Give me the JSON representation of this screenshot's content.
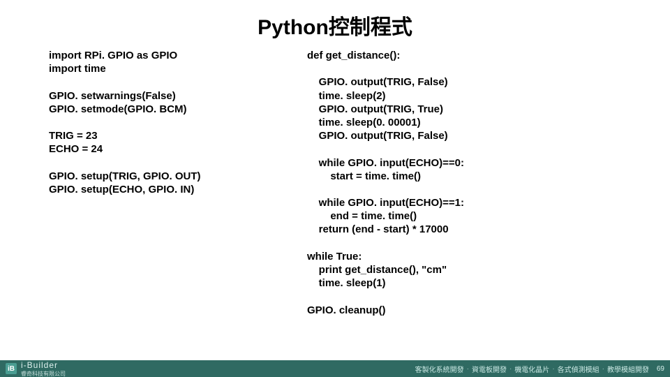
{
  "title": "Python控制程式",
  "left_code": "import RPi. GPIO as GPIO\nimport time\n\nGPIO. setwarnings(False)\nGPIO. setmode(GPIO. BCM)\n\nTRIG = 23\nECHO = 24\n\nGPIO. setup(TRIG, GPIO. OUT)\nGPIO. setup(ECHO, GPIO. IN)",
  "right_code": "def get_distance():\n\n    GPIO. output(TRIG, False)\n    time. sleep(2)\n    GPIO. output(TRIG, True)\n    time. sleep(0. 00001)\n    GPIO. output(TRIG, False)\n\n    while GPIO. input(ECHO)==0:\n        start = time. time()\n\n    while GPIO. input(ECHO)==1:\n        end = time. time()\n    return (end - start) * 17000\n\nwhile True:\n    print get_distance(), \"cm\"\n    time. sleep(1)\n\nGPIO. cleanup()",
  "footer": {
    "brand_icon": "iB",
    "brand_main": "i-Builder",
    "brand_sub": "睿奇科技有限公司",
    "tags": [
      "客製化系統開發",
      "資電板開發",
      "機電化晶片",
      "各式偵測模組",
      "教學模組開發"
    ],
    "page": "69"
  }
}
